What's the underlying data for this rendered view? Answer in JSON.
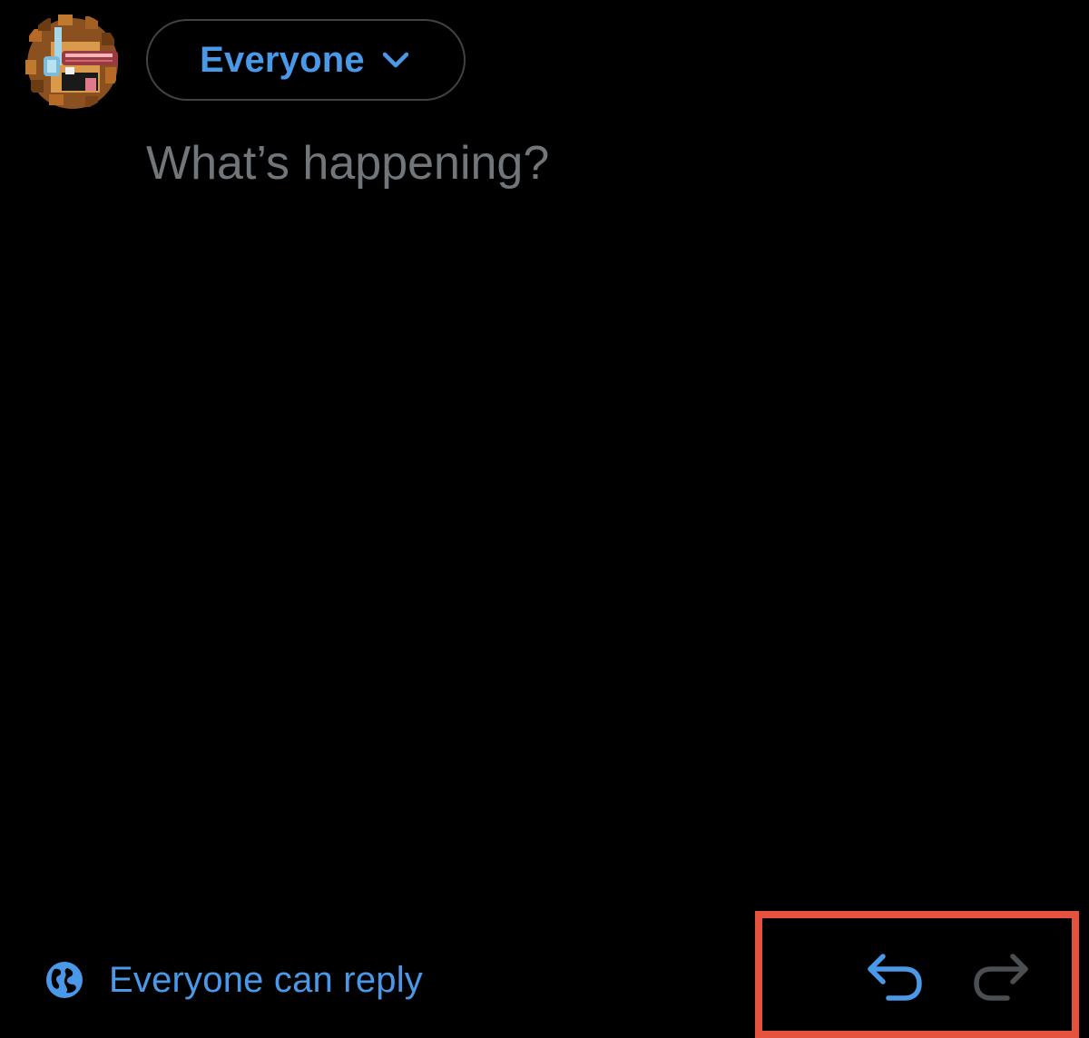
{
  "composer": {
    "audience": {
      "label": "Everyone",
      "chevron_icon": "chevron-down-icon"
    },
    "input": {
      "value": "",
      "placeholder": "What’s happening?"
    },
    "reply_setting": {
      "icon": "globe-icon",
      "label": "Everyone can reply"
    },
    "history_controls": {
      "undo_icon": "undo-icon",
      "redo_icon": "redo-icon",
      "undo_enabled": true,
      "redo_enabled": false
    }
  },
  "colors": {
    "background": "#000000",
    "accent": "#4a99e9",
    "placeholder": "#71767b",
    "pill_border": "#3e4347",
    "disabled_icon": "#4b4f53",
    "highlight": "#e5533f"
  }
}
